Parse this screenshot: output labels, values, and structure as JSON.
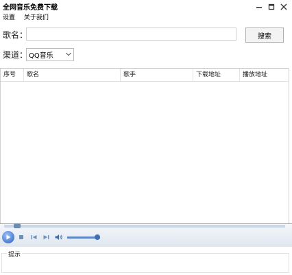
{
  "window": {
    "title": "全网音乐免费下载"
  },
  "menu": {
    "items": [
      "设置",
      "关于我们"
    ]
  },
  "search": {
    "label": "歌名：",
    "value": "",
    "placeholder": "",
    "button_label": "搜索"
  },
  "channel": {
    "label": "渠道：",
    "selected": "QQ音乐"
  },
  "table": {
    "columns": [
      "序号",
      "歌名",
      "歌手",
      "下载地址",
      "播放地址"
    ],
    "rows": []
  },
  "status": {
    "label": "提示",
    "text": ""
  },
  "icons": {
    "minimize": "minimize-icon",
    "maximize": "maximize-icon",
    "close": "close-icon",
    "play": "play-icon",
    "stop": "stop-icon",
    "prev": "previous-icon",
    "next": "next-icon",
    "volume": "volume-icon",
    "dropdown": "chevron-down-icon"
  },
  "colors": {
    "accent": "#2a5fb5",
    "player_border": "#7ea2c9"
  }
}
